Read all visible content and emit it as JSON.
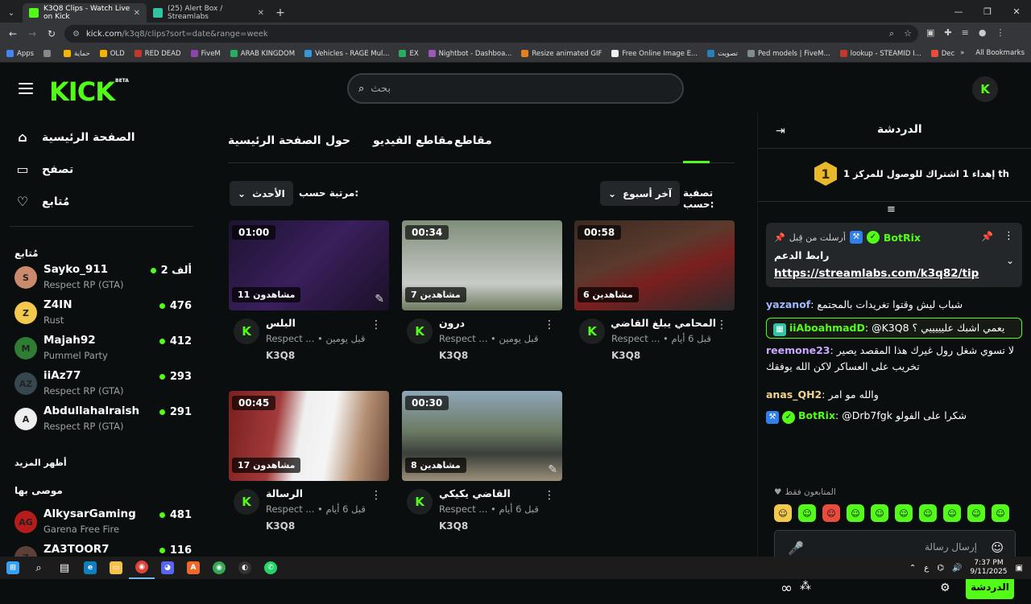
{
  "browser": {
    "tabs": [
      {
        "label": "K3Q8 Clips - Watch Live on Kick",
        "active": true,
        "favicon_color": "#53fc18"
      },
      {
        "label": "(25) Alert Box / Streamlabs",
        "active": false,
        "favicon_color": "#31c3a2"
      }
    ],
    "url_host": "kick.com",
    "url_path": "/k3q8/clips?sort=date&range=week",
    "bookmarks": [
      {
        "label": "Apps",
        "color": "#4285f4"
      },
      {
        "label": "",
        "color": "#888888"
      },
      {
        "label": "حماية",
        "color": "#f4b400"
      },
      {
        "label": "OLD",
        "color": "#f4b400"
      },
      {
        "label": "RED DEAD",
        "color": "#c0392b"
      },
      {
        "label": "FiveM",
        "color": "#8e44ad"
      },
      {
        "label": "ARAB KINGDOM",
        "color": "#27ae60"
      },
      {
        "label": "Vehicles - RAGE Mul...",
        "color": "#3498db"
      },
      {
        "label": "EX",
        "color": "#27ae60"
      },
      {
        "label": "Nightbot - Dashboa...",
        "color": "#9b59b6"
      },
      {
        "label": "Resize animated GIF",
        "color": "#e67e22"
      },
      {
        "label": "Free Online Image E...",
        "color": "#ecf0f1"
      },
      {
        "label": "تصويت",
        "color": "#2980b9"
      },
      {
        "label": "Ped models | FiveM...",
        "color": "#7f8c8d"
      },
      {
        "label": "lookup - STEAMID I...",
        "color": "#c0392b"
      },
      {
        "label": "Decimal to Hexadec...",
        "color": "#e74c3c"
      }
    ],
    "all_bookmarks": "All Bookmarks"
  },
  "kick": {
    "logo": "KICK",
    "logo_badge": "BETA",
    "search_placeholder": "بحث",
    "accent": "#53fc18",
    "sidebar": {
      "nav": [
        {
          "label": "الصفحة الرئيسية",
          "icon": "home-icon"
        },
        {
          "label": "تصفح",
          "icon": "browse-icon"
        },
        {
          "label": "مُتابع",
          "icon": "heart-icon"
        }
      ],
      "following_heading": "مُتابع",
      "following": [
        {
          "name": "Sayko_911",
          "category": "Respect RP (GTA)",
          "viewers": "2 ألف",
          "avatar_color": "#c98b6b",
          "initial": "S"
        },
        {
          "name": "Z4IN",
          "category": "Rust",
          "viewers": "476",
          "avatar_color": "#f2c94c",
          "initial": "Z"
        },
        {
          "name": "Majah92",
          "category": "Pummel Party",
          "viewers": "412",
          "avatar_color": "#2e7d32",
          "initial": "M"
        },
        {
          "name": "iiAz77",
          "category": "Respect RP (GTA)",
          "viewers": "293",
          "avatar_color": "#37474f",
          "initial": "AZ"
        },
        {
          "name": "Abdullahalraish",
          "category": "Respect RP (GTA)",
          "viewers": "291",
          "avatar_color": "#eeeeee",
          "initial": "A"
        }
      ],
      "show_more": "أظهر المزيد",
      "recommended_heading": "موصى بها",
      "recommended": [
        {
          "name": "AlkysarGaming",
          "category": "Garena Free Fire",
          "viewers": "481",
          "avatar_color": "#b71c1c",
          "initial": "AG"
        },
        {
          "name": "ZA3TOOR7",
          "category": "",
          "viewers": "116",
          "avatar_color": "#5d4037",
          "initial": "Z"
        }
      ]
    },
    "tabs": {
      "home": "الصفحة الرئيسية",
      "about": "حول",
      "videos": "مقاطع الفيديو",
      "clips": "مقاطع"
    },
    "filters": {
      "sort_label": "مرتبة حسب:",
      "sort_value": "الأحدث",
      "filter_label": "تصفية حسب:",
      "filter_value": "آخر أسبوع"
    },
    "clips": [
      {
        "duration": "00:58",
        "views": "6 مشاهدين",
        "title": "المحامي يبلغ القاضي ...",
        "time": "قبل 6 أيام",
        "category": "Respect ...",
        "user": "K3Q8",
        "thumb": "linear-gradient(160deg,#3b2a22 0%,#5a3a2c 40%,#7a1f1f 60%,#2b2b2b 100%)",
        "leaf": false
      },
      {
        "duration": "00:34",
        "views": "7 مشاهدين",
        "title": "درون",
        "time": "قبل يومين",
        "category": "Respect ...",
        "user": "K3Q8",
        "thumb": "linear-gradient(180deg,#7f8f7a 0%,#a9b0a6 40%,#c8ccc8 70%,#6c7a5e 100%)",
        "leaf": false
      },
      {
        "duration": "01:00",
        "views": "11 مشاهدون",
        "title": "البلس",
        "time": "قبل يومين",
        "category": "Respect ...",
        "user": "K3Q8",
        "thumb": "linear-gradient(135deg,#1c1330 0%,#3a1f5c 50%,#1a1026 100%)",
        "leaf": true
      },
      {
        "duration": "00:30",
        "views": "8 مشاهدين",
        "title": "القاضي يكيكي",
        "time": "قبل 6 أيام",
        "category": "Respect ...",
        "user": "K3Q8",
        "thumb": "linear-gradient(180deg,#8fa6b8 0%,#6b7a63 45%,#3a3f3a 70%,#9c8f7a 100%)",
        "leaf": true
      },
      {
        "duration": "00:45",
        "views": "17 مشاهدون",
        "title": "الرسالة",
        "time": "قبل 6 أيام",
        "category": "Respect ...",
        "user": "K3Q8",
        "thumb": "linear-gradient(100deg,#7a1f1f 0%,#a23a3a 30%,#efefef 45%,#f5f5f5 62%,#b58f73 80%,#6a4a3a 100%)",
        "leaf": false
      }
    ],
    "chat": {
      "title": "الدردشة",
      "goal_rank": "1",
      "goal_text": "إهداء 1 اشتراك للوصول للمركز 1 th",
      "pinned": {
        "sent_by": "أرسلت من قِبل",
        "user": "BotRix",
        "label": "رابط الدعم",
        "link": "https://streamlabs.com/k3q82/tip"
      },
      "messages": [
        {
          "user": "yazanof",
          "color": "#a3b8ff",
          "text": "شباب ليش وقتوا تغريدات بالمجتمع"
        },
        {
          "user": "iiAboahmadD",
          "color": "#53fc18",
          "text": "@K3Q8 يعمي اشبك عليييييي ؟",
          "highlight": true
        },
        {
          "user": "reemone23",
          "color": "#c9a7ff",
          "text": "لا تسوي شغل رول غيرك هذا المقصد يصير تخريب على العساكر لاكن الله يوفقك"
        },
        {
          "user": "anas_QH2",
          "color": "#f2d48c",
          "text": "والله مو امر"
        },
        {
          "user": "BotRix",
          "color": "#53fc18",
          "text": "@Drb7fgk شكرا على الفولو"
        }
      ],
      "followers_only": "المتابعون فقط",
      "input_placeholder": "إرسال رسالة",
      "send_button": "الدردشة"
    }
  },
  "taskbar": {
    "time": "7:37 PM",
    "date": "9/11/2025",
    "lang": "ع"
  }
}
